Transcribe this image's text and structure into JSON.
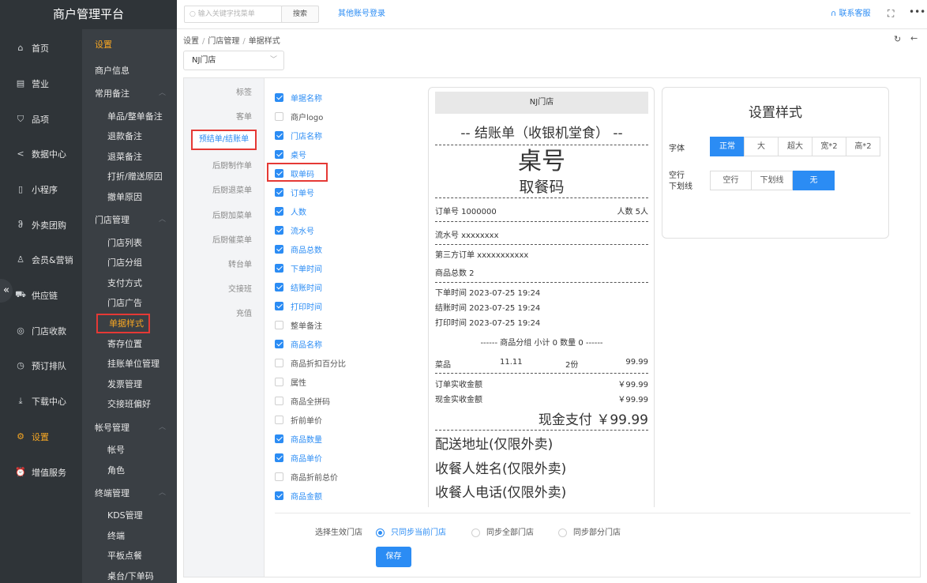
{
  "app": {
    "title": "商户管理平台"
  },
  "topbar": {
    "search_placeholder": "输入关键字找菜单",
    "search_button": "搜索",
    "other_login": "其他账号登录",
    "contact": "联系客服"
  },
  "nav": [
    {
      "label": "首页",
      "icon": "home-icon"
    },
    {
      "label": "营业",
      "icon": "calendar-icon"
    },
    {
      "label": "品项",
      "icon": "bag-icon"
    },
    {
      "label": "数据中心",
      "icon": "share-icon"
    },
    {
      "label": "小程序",
      "icon": "phone-icon"
    },
    {
      "label": "外卖团购",
      "icon": "bike-icon"
    },
    {
      "label": "会员&营销",
      "icon": "user-icon"
    },
    {
      "label": "供应链",
      "icon": "truck-icon"
    },
    {
      "label": "门店收款",
      "icon": "coins-icon"
    },
    {
      "label": "预订排队",
      "icon": "clock-icon"
    },
    {
      "label": "下载中心",
      "icon": "download-icon"
    },
    {
      "label": "设置",
      "icon": "gear-icon",
      "active": true
    },
    {
      "label": "增值服务",
      "icon": "alarm-icon"
    }
  ],
  "subnav": {
    "title": "设置",
    "items": [
      {
        "label": "商户信息",
        "type": "head"
      },
      {
        "label": "常用备注",
        "type": "group"
      },
      {
        "label": "单品/整单备注",
        "type": "item"
      },
      {
        "label": "退款备注",
        "type": "item"
      },
      {
        "label": "退菜备注",
        "type": "item"
      },
      {
        "label": "打折/赠送原因",
        "type": "item"
      },
      {
        "label": "撤单原因",
        "type": "item"
      },
      {
        "label": "门店管理",
        "type": "group"
      },
      {
        "label": "门店列表",
        "type": "item"
      },
      {
        "label": "门店分组",
        "type": "item"
      },
      {
        "label": "支付方式",
        "type": "item"
      },
      {
        "label": "门店广告",
        "type": "item"
      },
      {
        "label": "单据样式",
        "type": "item",
        "selected": true
      },
      {
        "label": "寄存位置",
        "type": "item"
      },
      {
        "label": "挂账单位管理",
        "type": "item"
      },
      {
        "label": "发票管理",
        "type": "item"
      },
      {
        "label": "交接班偏好",
        "type": "item"
      },
      {
        "label": "帐号管理",
        "type": "group"
      },
      {
        "label": "帐号",
        "type": "item"
      },
      {
        "label": "角色",
        "type": "item"
      },
      {
        "label": "终端管理",
        "type": "group"
      },
      {
        "label": "KDS管理",
        "type": "item"
      },
      {
        "label": "终端",
        "type": "item"
      },
      {
        "label": "平板点餐",
        "type": "item"
      },
      {
        "label": "桌台/下单码",
        "type": "item"
      }
    ]
  },
  "breadcrumb": [
    "设置",
    "门店管理",
    "单据样式"
  ],
  "store_select": "NJ门店",
  "tabs": [
    "标签",
    "客单",
    "预结单/结账单",
    "后厨制作单",
    "后厨退菜单",
    "后厨加菜单",
    "后厨催菜单",
    "转台单",
    "交接班",
    "充值"
  ],
  "active_tab": "预结单/结账单",
  "fields": [
    {
      "label": "单据名称",
      "checked": true
    },
    {
      "label": "商户logo",
      "checked": false
    },
    {
      "label": "门店名称",
      "checked": true
    },
    {
      "label": "桌号",
      "checked": true
    },
    {
      "label": "取单码",
      "checked": true
    },
    {
      "label": "订单号",
      "checked": true
    },
    {
      "label": "人数",
      "checked": true
    },
    {
      "label": "流水号",
      "checked": true
    },
    {
      "label": "商品总数",
      "checked": true
    },
    {
      "label": "下单时间",
      "checked": true
    },
    {
      "label": "结账时间",
      "checked": true
    },
    {
      "label": "打印时间",
      "checked": true
    },
    {
      "label": "整单备注",
      "checked": false
    },
    {
      "label": "商品名称",
      "checked": true
    },
    {
      "label": "商品折扣百分比",
      "checked": false
    },
    {
      "label": "属性",
      "checked": false
    },
    {
      "label": "商品全拼码",
      "checked": false
    },
    {
      "label": "折前单价",
      "checked": false
    },
    {
      "label": "商品数量",
      "checked": true
    },
    {
      "label": "商品单价",
      "checked": true
    },
    {
      "label": "商品折前总价",
      "checked": false
    },
    {
      "label": "商品金额",
      "checked": true
    }
  ],
  "receipt": {
    "store": "NJ门店",
    "title": "-- 结账单（收银机堂食） --",
    "table_no": "桌号",
    "pickup_code": "取餐码",
    "order_no": "订单号 1000000",
    "people": "人数 5人",
    "serial": "流水号 xxxxxxxx",
    "third_party": "第三方订单 xxxxxxxxxxx",
    "total_items": "商品总数 2",
    "order_time": "下单时间 2023-07-25 19:24",
    "checkout_time": "结账时间 2023-07-25 19:24",
    "print_time": "打印时间 2023-07-25 19:24",
    "group_line": "------ 商品分组 小计 0 数量 0 ------",
    "item_name": "菜品",
    "item_price": "11.11",
    "item_qty": "2份",
    "item_amount": "99.99",
    "order_paid_label": "订单实收金额",
    "order_paid": "￥99.99",
    "cash_paid_label": "现金实收金额",
    "cash_paid": "￥99.99",
    "cash_pay": "现金支付 ￥99.99",
    "address": "配送地址(仅限外卖)",
    "receiver_name": "收餐人姓名(仅限外卖)",
    "receiver_phone": "收餐人电话(仅限外卖)"
  },
  "style_settings": {
    "title": "设置样式",
    "font_label": "字体",
    "font_options": [
      "正常",
      "大",
      "超大",
      "宽*2",
      "高*2"
    ],
    "font_selected": "正常",
    "spacing_label_1": "空行",
    "spacing_label_2": "下划线",
    "spacing_options": [
      "空行",
      "下划线",
      "无"
    ],
    "spacing_selected": "无"
  },
  "apply": {
    "label": "选择生效门店",
    "options": [
      "只同步当前门店",
      "同步全部门店",
      "同步部分门店"
    ],
    "selected": "只同步当前门店",
    "save": "保存"
  },
  "colors": {
    "accent": "#2b8cf4",
    "highlight": "#e53935",
    "nav_active": "#f5a623",
    "sidebar": "#2f3438"
  }
}
